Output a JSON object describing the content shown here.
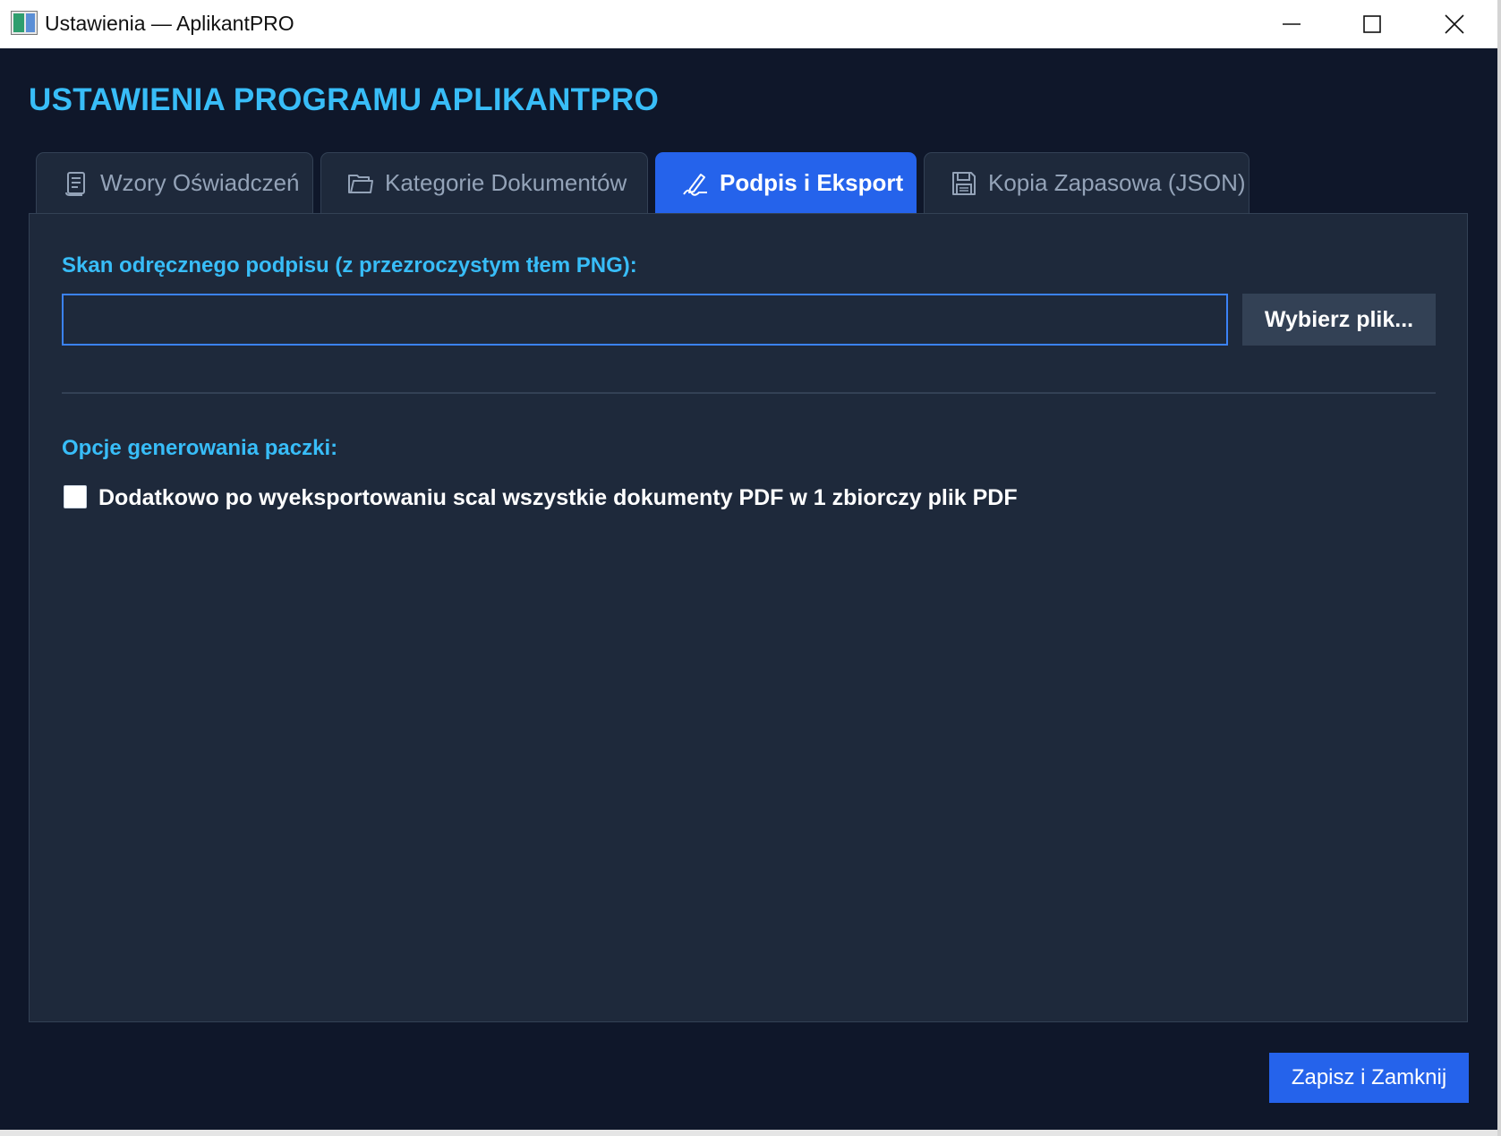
{
  "window": {
    "title": "Ustawienia — AplikantPRO",
    "icon": "app-icon"
  },
  "heading": "USTAWIENIA PROGRAMU APLIKANTPRO",
  "tabs": [
    {
      "label": "Wzory Oświadczeń",
      "icon": "scroll-icon",
      "active": false
    },
    {
      "label": "Kategorie Dokumentów",
      "icon": "folder-icon",
      "active": false
    },
    {
      "label": "Podpis i Eksport",
      "icon": "signature-pen-icon",
      "active": true
    },
    {
      "label": "Kopia Zapasowa (JSON)",
      "icon": "floppy-disk-icon",
      "active": false
    }
  ],
  "signature": {
    "label": "Skan odręcznego podpisu (z przezroczystym tłem PNG):",
    "path_value": "",
    "browse_label": "Wybierz plik..."
  },
  "options": {
    "label": "Opcje generowania paczki:",
    "merge_pdf_label": "Dodatkowo po wyeksportowaniu scal wszystkie dokumenty PDF w 1 zbiorczy plik PDF",
    "merge_pdf_checked": false
  },
  "footer": {
    "save_close_label": "Zapisz i Zamknij"
  },
  "colors": {
    "background": "#0f172a",
    "panel": "#1e293b",
    "accent": "#38bdf8",
    "primary": "#2563eb",
    "border": "#334155"
  }
}
